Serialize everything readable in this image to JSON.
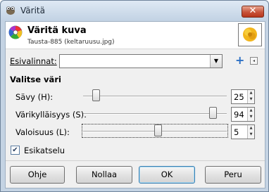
{
  "window": {
    "title": "Väritä",
    "close_glyph": "✕"
  },
  "header": {
    "title": "Väritä kuva",
    "subtitle": "Tausta-885 (keltaruusu.jpg)",
    "icon": "colorize-icon"
  },
  "presets": {
    "label": "Esivalinnat:",
    "value": "",
    "add_icon": "+",
    "menu_icon": "◂"
  },
  "section": {
    "title": "Valitse väri"
  },
  "sliders": [
    {
      "label": "Sävy (H):",
      "value": "25",
      "max": 360
    },
    {
      "label": "Värikylläisyys (S):",
      "value": "94",
      "max": 100
    },
    {
      "label": "Valoisuus (L):",
      "value": "5",
      "min": -100,
      "max": 100
    }
  ],
  "preview": {
    "label": "Esikatselu",
    "checked": true,
    "check_glyph": "✔"
  },
  "buttons": {
    "help": "Ohje",
    "reset": "Nollaa",
    "ok": "OK",
    "cancel": "Peru"
  },
  "colors": {
    "titlebar": "#c9d8e8",
    "close": "#c8543b",
    "accent": "#2b6fc4",
    "dialog_bg": "#f0f0f0"
  }
}
